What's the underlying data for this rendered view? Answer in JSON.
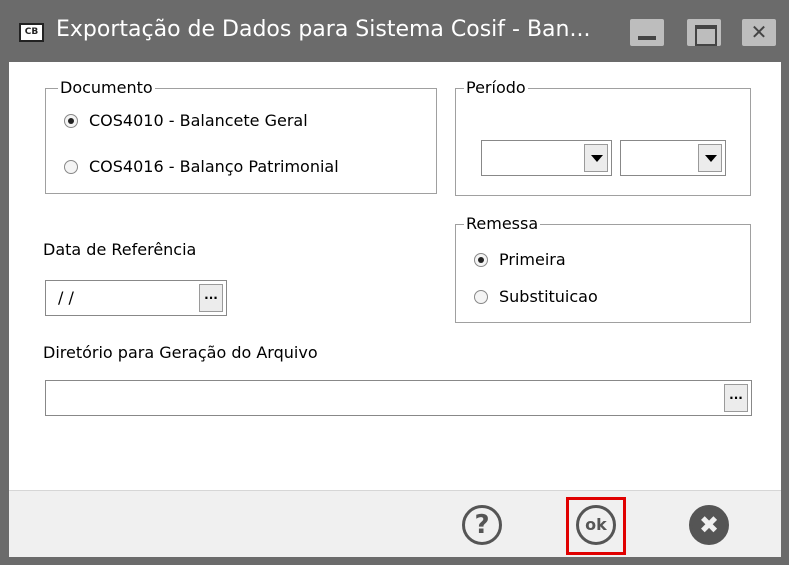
{
  "window": {
    "title": "Exportação de Dados para Sistema Cosif - Ban...",
    "app_icon_text": "CB",
    "close_glyph": "✕"
  },
  "documento": {
    "legend": "Documento",
    "options": [
      {
        "label": "COS4010 - Balancete Geral",
        "checked": true
      },
      {
        "label": "COS4016 - Balanço Patrimonial",
        "checked": false
      }
    ]
  },
  "periodo": {
    "legend": "Período",
    "combo1_value": "",
    "combo2_value": ""
  },
  "remessa": {
    "legend": "Remessa",
    "options": [
      {
        "label": "Primeira",
        "checked": true
      },
      {
        "label": "Substituicao",
        "checked": false
      }
    ]
  },
  "data_referencia": {
    "label": "Data de Referência",
    "value": "/ /",
    "button": "..."
  },
  "diretorio": {
    "label": "Diretório para Geração do Arquivo",
    "value": "",
    "button": "..."
  },
  "footer": {
    "help_glyph": "?",
    "ok_label": "ok",
    "cancel_glyph": "✖",
    "highlight_color": "#e00000"
  }
}
